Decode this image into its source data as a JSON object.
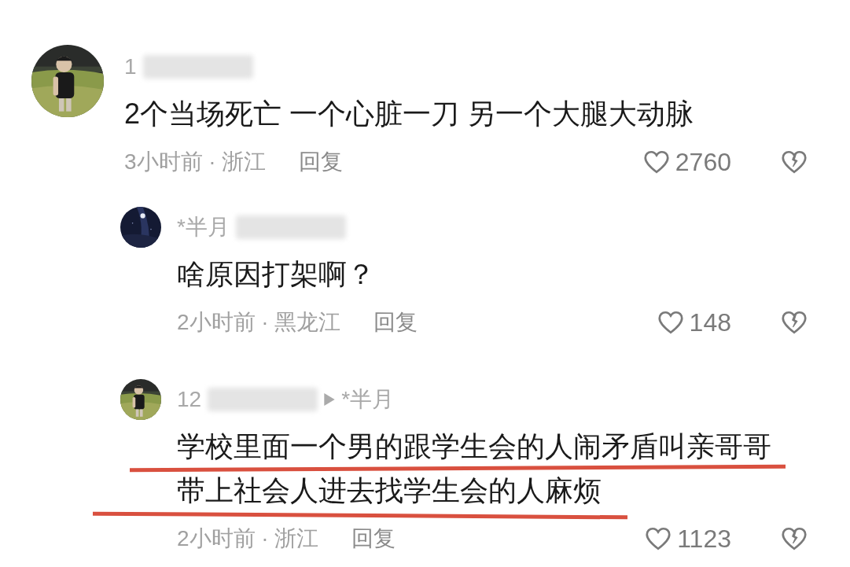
{
  "comments": [
    {
      "author": "1",
      "avatar": {
        "kind": "picture"
      },
      "lines": [
        "2个当场死亡 一个心脏一刀 另一个大腿大动脉"
      ],
      "underlined": false,
      "time": "3小时前 · 浙江",
      "reply": "回复",
      "likes": "2760",
      "replies": [
        {
          "author": "*半月",
          "avatar": {
            "kind": "picture"
          },
          "lines": [
            "啥原因打架啊？"
          ],
          "underlined": false,
          "time": "2小时前 · 黑龙江",
          "reply": "回复",
          "likes": "148"
        },
        {
          "author": "12",
          "reply_to": "*半月",
          "avatar": {
            "kind": "picture"
          },
          "lines": [
            "学校里面一个男的跟学生会的人闹矛盾叫亲哥哥",
            "带上社会人进去找学生会的人麻烦"
          ],
          "underlined": true,
          "time": "2小时前 · 浙江",
          "reply": "回复",
          "likes": "1123"
        }
      ]
    }
  ]
}
